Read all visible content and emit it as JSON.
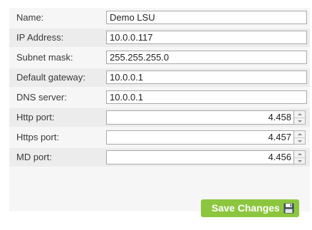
{
  "form": {
    "fields": [
      {
        "label": "Name:",
        "value": "Demo LSU"
      },
      {
        "label": "IP Address:",
        "value": "10.0.0.117"
      },
      {
        "label": "Subnet mask:",
        "value": "255.255.255.0"
      },
      {
        "label": "Default gateway:",
        "value": "10.0.0.1"
      },
      {
        "label": "DNS server:",
        "value": "10.0.0.1"
      }
    ],
    "ports": [
      {
        "label": "Http port:",
        "value": "4.458"
      },
      {
        "label": "Https port:",
        "value": "4.457"
      },
      {
        "label": "MD port:",
        "value": "4.456"
      }
    ]
  },
  "actions": {
    "save_label": "Save Changes",
    "save_icon": "floppy-disk-icon"
  },
  "colors": {
    "accent": "#8cc63f",
    "panel_bg": "#f6f6f6",
    "row_alt_bg": "#ececec"
  }
}
